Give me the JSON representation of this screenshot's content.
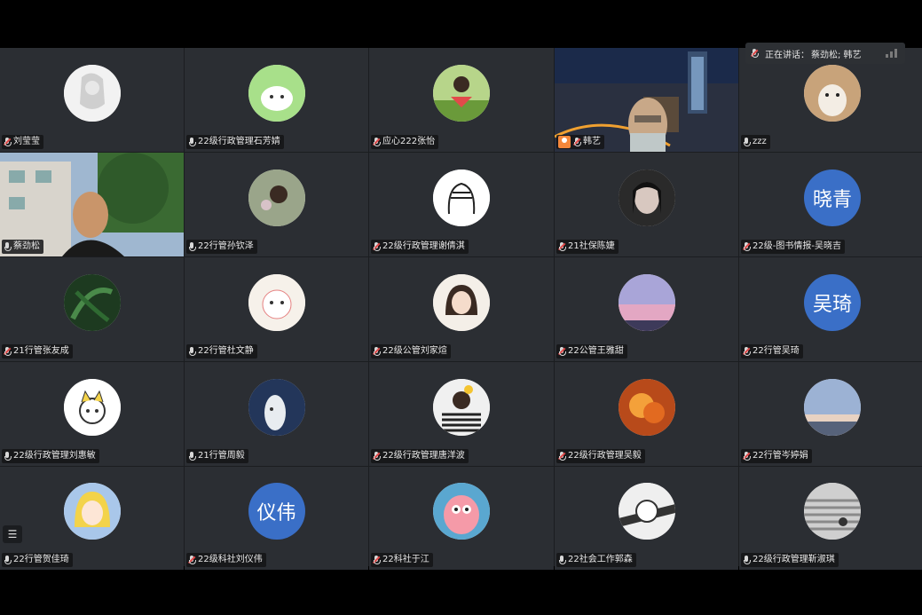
{
  "speaking": {
    "label": "正在讲话：",
    "name": "蔡劲松; 韩艺"
  },
  "tiles": [
    {
      "name": "刘莹莹",
      "avatar": "sketch-girl",
      "muted": true
    },
    {
      "name": "22级行政管理石芳婧",
      "avatar": "green-cartoon",
      "muted": false
    },
    {
      "name": "应心222张怡",
      "avatar": "watermelon-girl",
      "muted": true
    },
    {
      "name": "韩艺",
      "avatar": "video-city",
      "muted": true,
      "host": true
    },
    {
      "name": "zzz",
      "avatar": "cat",
      "muted": false
    },
    {
      "name": "蔡劲松",
      "avatar": "video-man",
      "muted": false,
      "speaker": true
    },
    {
      "name": "22行管孙钦泽",
      "avatar": "flower-girl",
      "muted": false
    },
    {
      "name": "22级行政管理谢倩淇",
      "avatar": "line-art",
      "muted": true
    },
    {
      "name": "21社保陈婕",
      "avatar": "dark-girl",
      "muted": true
    },
    {
      "name": "22级-图书情报-吴晓吉",
      "avatar": "text",
      "avatar_text": "晓青",
      "muted": true
    },
    {
      "name": "21行管张友成",
      "avatar": "leaves",
      "muted": true
    },
    {
      "name": "22行管杜文静",
      "avatar": "pink-cartoon",
      "muted": false
    },
    {
      "name": "22级公管刘家煊",
      "avatar": "cartoon-girl",
      "muted": true
    },
    {
      "name": "22公管王雅甜",
      "avatar": "sky-pink",
      "muted": true
    },
    {
      "name": "22行管吴琦",
      "avatar": "text",
      "avatar_text": "吴琦",
      "muted": true
    },
    {
      "name": "22级行政管理刘惠敏",
      "avatar": "cute-cat",
      "muted": false
    },
    {
      "name": "21行管周毅",
      "avatar": "white-figure",
      "muted": false
    },
    {
      "name": "22级行政管理唐洋波",
      "avatar": "striped-girl",
      "muted": true
    },
    {
      "name": "22级行政管理吴毅",
      "avatar": "fire",
      "muted": true
    },
    {
      "name": "22行管岑婷娟",
      "avatar": "sunset",
      "muted": true
    },
    {
      "name": "22行管贺佳琦",
      "avatar": "anime",
      "muted": false
    },
    {
      "name": "22级科社刘仪伟",
      "avatar": "text",
      "avatar_text": "仪伟",
      "muted": true
    },
    {
      "name": "22科社于江",
      "avatar": "patrick",
      "muted": true
    },
    {
      "name": "22社会工作郭森",
      "avatar": "astronaut",
      "muted": false
    },
    {
      "name": "22级行政管理靳淑琪",
      "avatar": "stairs",
      "muted": false
    }
  ]
}
